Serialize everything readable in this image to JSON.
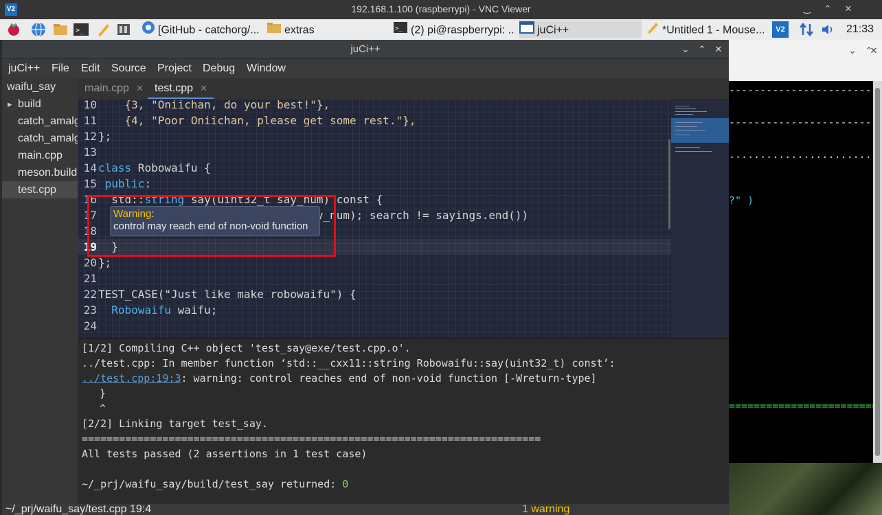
{
  "vnc": {
    "title": "192.168.1.100 (raspberrypi) - VNC Viewer",
    "logo": "V2",
    "minimize": "⌃",
    "restore": "⌃",
    "close": "✕"
  },
  "taskbar": {
    "tasks": [
      {
        "label": "[GitHub - catchorg/...",
        "icon": "chromium-icon"
      },
      {
        "label": "extras",
        "icon": "folder-icon"
      },
      {
        "label": "(2) pi@raspberrypi: ...",
        "icon": "terminal-icon"
      },
      {
        "label": "juCi++",
        "icon": "window-icon"
      },
      {
        "label": "*Untitled 1 - Mouse...",
        "icon": "pencil-icon"
      }
    ],
    "clock": "21:33"
  },
  "window": {
    "title": "juCi++"
  },
  "menu": [
    "juCi++",
    "File",
    "Edit",
    "Source",
    "Project",
    "Debug",
    "Window"
  ],
  "sidebar": {
    "project": "waifu_say",
    "items": [
      "build",
      "catch_amalg",
      "catch_amalg",
      "main.cpp",
      "meson.build",
      "test.cpp"
    ],
    "expander": "▸",
    "selected": 5
  },
  "tabs": [
    {
      "label": "main.cpp",
      "close": "✕",
      "active": false
    },
    {
      "label": "test.cpp",
      "close": "✕",
      "active": true
    }
  ],
  "editor": {
    "lines": [
      {
        "n": "10",
        "text": "    {3, \"Oniichan, do your best!\"},"
      },
      {
        "n": "11",
        "text": "    {4, \"Poor Oniichan, please get some rest.\"},"
      },
      {
        "n": "12",
        "text": "};"
      },
      {
        "n": "13",
        "text": ""
      },
      {
        "n": "14",
        "kw": "class",
        "text": " Robowaifu {"
      },
      {
        "n": "15",
        "kw": " public",
        "text": ":"
      },
      {
        "n": "16",
        "pre": "  std::",
        "kw": "string",
        "text": " say(uint32_t say_num) const {"
      },
      {
        "n": "17",
        "text": "                             d(say_num); search != sayings.end())"
      },
      {
        "n": "18",
        "text": ""
      },
      {
        "n": "19",
        "text": "  }"
      },
      {
        "n": "20",
        "text": "};"
      },
      {
        "n": "21",
        "text": ""
      },
      {
        "n": "22",
        "text": "TEST_CASE(\"Just like make robowaifu\") {"
      },
      {
        "n": "23",
        "pre": "  ",
        "kw": "Robowaifu",
        "text": " waifu;"
      },
      {
        "n": "24",
        "text": ""
      }
    ],
    "current_line": "19"
  },
  "tooltip": {
    "title": "Warning",
    "colon": ":",
    "body": "control may reach end of non-void function"
  },
  "terminal": {
    "lines": [
      "[1/2] Compiling C++ object 'test_say@exe/test.cpp.o'.",
      "../test.cpp: In member function ‘std::__cxx11::string Robowaifu::say(uint32_t) const’:",
      "  }",
      "  ^",
      "[2/2] Linking target test_say.",
      "==========================================================================",
      "All tests passed (2 assertions in 1 test case)",
      ""
    ],
    "warning_link": "../test.cpp:19:3",
    "warning_text": ": warning: control reaches end of non-void function [-Wreturn-type]",
    "returned_prefix": "~/_prj/waifu_say/build/test_say returned: ",
    "returned_code": "0"
  },
  "status": {
    "path": "~/_prj/waifu_say/test.cpp 19:4",
    "warnings": "1 warning"
  },
  "right_terminal": {
    "lines": [
      {
        "text": "-------------------------",
        "color": "#cfcfcf"
      },
      {
        "text": "-------------------------",
        "color": "#cfcfcf"
      },
      {
        "text": ".........................",
        "color": "#cfcfcf"
      },
      {
        "text": "?\" )",
        "color": "#38c7d8"
      },
      {
        "text": "=========================",
        "color": "#3ee04a"
      }
    ]
  },
  "colors": {
    "accent": "#5b8ed6",
    "warning": "#f0c800",
    "highlight_box": "#e0101a"
  }
}
